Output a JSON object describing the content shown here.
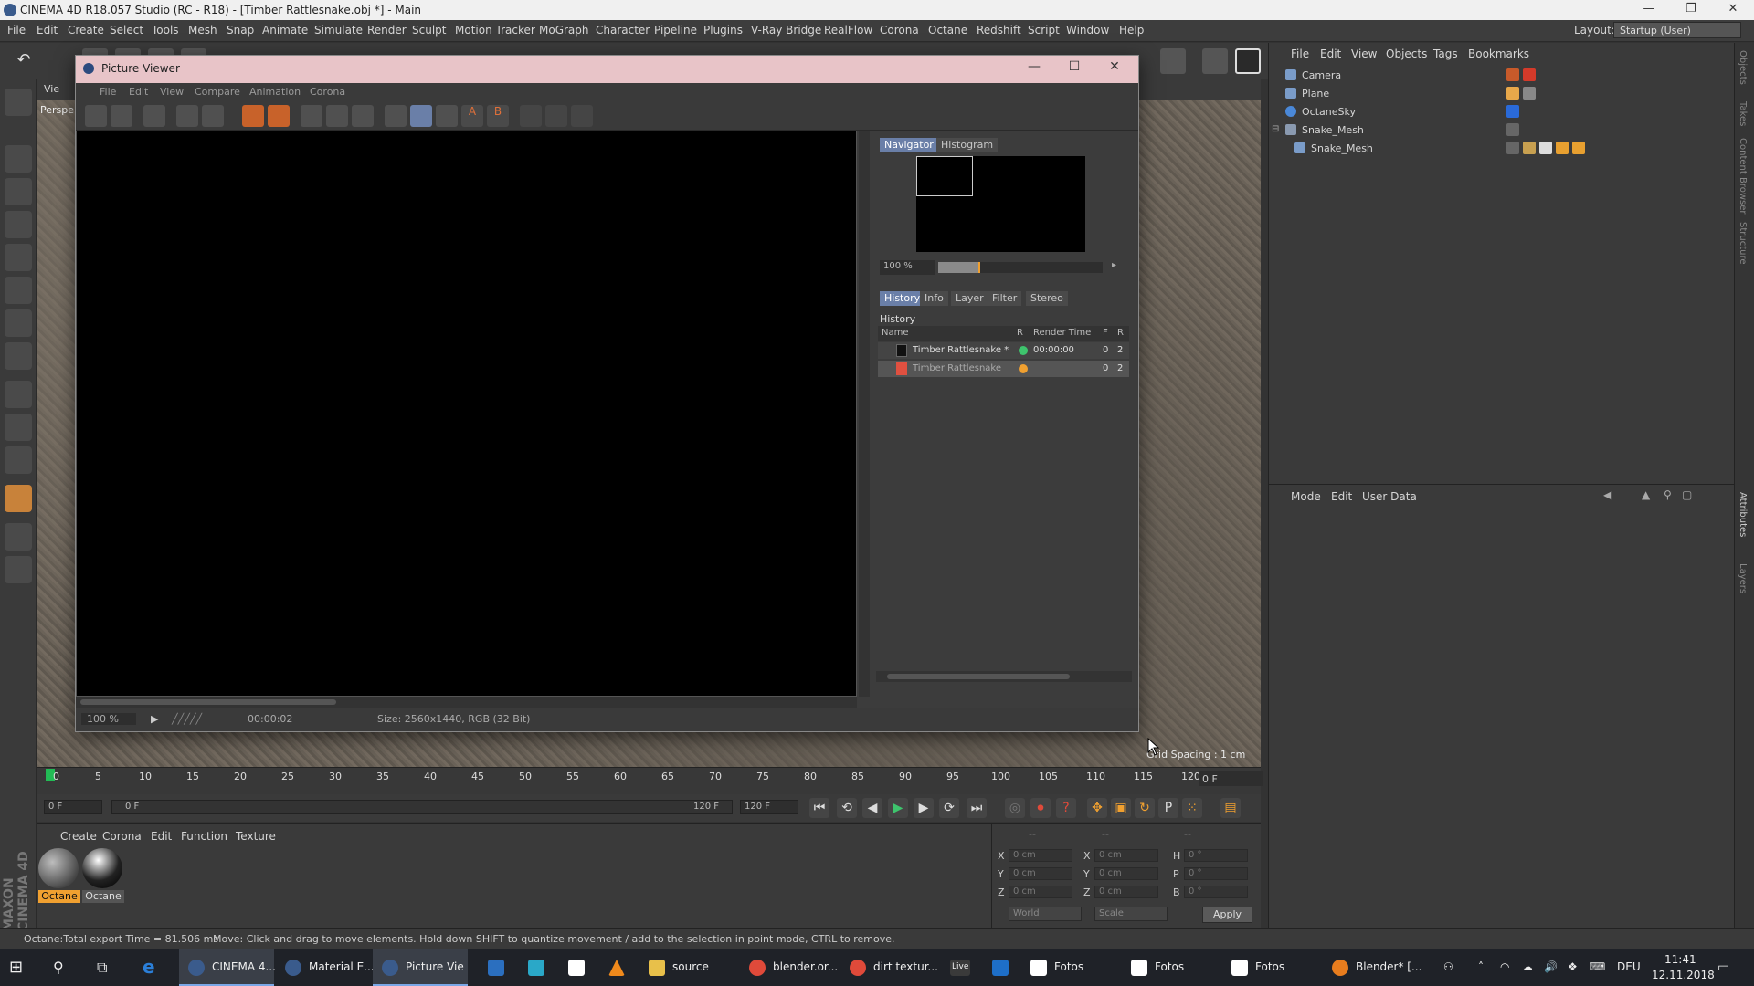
{
  "window": {
    "title": "CINEMA 4D R18.057 Studio (RC - R18) - [Timber Rattlesnake.obj *] - Main",
    "controls": [
      "—",
      "❐",
      "✕"
    ]
  },
  "menubar": {
    "items": [
      "File",
      "Edit",
      "Create",
      "Select",
      "Tools",
      "Mesh",
      "Snap",
      "Animate",
      "Simulate",
      "Render",
      "Sculpt",
      "Motion Tracker",
      "MoGraph",
      "Character",
      "Pipeline",
      "Plugins",
      "V-Ray Bridge",
      "RealFlow",
      "Corona",
      "Octane",
      "Redshift",
      "Script",
      "Window",
      "Help"
    ],
    "layout_label": "Layout:",
    "layout_value": "Startup (User)"
  },
  "viewport": {
    "label": "Perspe",
    "menu_first": "Vie",
    "grid_spacing": "Grid Spacing : 1 cm"
  },
  "timeline": {
    "ticks": [
      "0",
      "5",
      "10",
      "15",
      "20",
      "25",
      "30",
      "35",
      "40",
      "45",
      "50",
      "55",
      "60",
      "65",
      "70",
      "75",
      "80",
      "85",
      "90",
      "95",
      "100",
      "105",
      "110",
      "115",
      "120"
    ],
    "current_frame_right": "0 F",
    "start_frame": "0 F",
    "range_start": "0 F",
    "range_end": "120 F",
    "end_frame": "120 F"
  },
  "material_manager": {
    "menu": [
      "Create",
      "Corona",
      "Edit",
      "Function",
      "Texture"
    ],
    "materials": [
      {
        "name": "Octane",
        "selected": true
      },
      {
        "name": "Octane",
        "selected": false
      }
    ],
    "brand": "MAXON CINEMA 4D"
  },
  "coordinates": {
    "headers": [
      "--",
      "--",
      "--"
    ],
    "rows": [
      {
        "a": "X",
        "av": "0 cm",
        "b": "X",
        "bv": "0 cm",
        "c": "H",
        "cv": "0 °"
      },
      {
        "a": "Y",
        "av": "0 cm",
        "b": "Y",
        "bv": "0 cm",
        "c": "P",
        "cv": "0 °"
      },
      {
        "a": "Z",
        "av": "0 cm",
        "b": "Z",
        "bv": "0 cm",
        "c": "B",
        "cv": "0 °"
      }
    ],
    "mode1": "World",
    "mode2": "Scale",
    "apply": "Apply"
  },
  "object_manager": {
    "menu": [
      "File",
      "Edit",
      "View",
      "Objects",
      "Tags",
      "Bookmarks"
    ],
    "objects": [
      {
        "name": "Camera",
        "icon_color": "#7a9cc9"
      },
      {
        "name": "Plane",
        "icon_color": "#7a9cc9"
      },
      {
        "name": "OctaneSky",
        "icon_color": "#4a88d8"
      },
      {
        "name": "Snake_Mesh",
        "icon_color": "#7a9cc9"
      },
      {
        "name": "Snake_Mesh",
        "icon_color": "#7a9cc9"
      }
    ]
  },
  "attribute_manager": {
    "menu": [
      "Mode",
      "Edit",
      "User Data"
    ]
  },
  "right_tabs": [
    "Objects",
    "Takes",
    "Content Browser",
    "Structure",
    "Attributes",
    "Layers"
  ],
  "statusbar": {
    "left": "Octane:Total export Time = 81.506 ms",
    "message": "Move: Click and drag to move elements. Hold down SHIFT to quantize movement / add to the selection in point mode, CTRL to remove."
  },
  "picture_viewer": {
    "title": "Picture Viewer",
    "controls": [
      "—",
      "☐",
      "✕"
    ],
    "menu": [
      "File",
      "Edit",
      "View",
      "Compare",
      "Animation",
      "Corona"
    ],
    "zoom": "100 %",
    "time": "00:00:02",
    "size_info": "Size: 2560x1440, RGB (32 Bit)",
    "panel_tabs": [
      "Navigator",
      "Histogram"
    ],
    "nav_zoom": "100 %",
    "nav_zoom_fraction": 0.25,
    "sub_tabs": [
      "History",
      "Info",
      "Layer",
      "Filter",
      "Stereo"
    ],
    "history_label": "History",
    "history_columns": [
      "Name",
      "R",
      "Render Time",
      "F",
      "R"
    ],
    "history": [
      {
        "name": "Timber Rattlesnake *",
        "status_color": "#3ec46d",
        "time": "00:00:00",
        "f": "0",
        "r": "2",
        "swatch": "#111111"
      },
      {
        "name": "Timber Rattlesnake",
        "status_color": "#f0a030",
        "time": "",
        "f": "0",
        "r": "2",
        "swatch": "#e05040"
      }
    ]
  },
  "taskbar": {
    "apps": [
      {
        "label": "CINEMA 4...",
        "color": "#3a5b8c",
        "active": true
      },
      {
        "label": "Material E...",
        "color": "#3a5b8c",
        "active": false
      },
      {
        "label": "Picture Vie",
        "color": "#3a5b8c",
        "active": true
      },
      {
        "label": "",
        "color": "#2b6fbf",
        "active": false
      },
      {
        "label": "",
        "color": "#2aa8c8",
        "active": false
      },
      {
        "label": "",
        "color": "#ffffff",
        "active": false
      },
      {
        "label": "",
        "color": "#f08a1c",
        "active": false
      },
      {
        "label": "source",
        "color": "#e8c04a",
        "active": false
      },
      {
        "label": "blender.or...",
        "color": "#e04a3a",
        "active": false
      },
      {
        "label": "dirt textur...",
        "color": "#e04a3a",
        "active": false
      },
      {
        "label": "Live",
        "color": "#3a3a3a",
        "active": false
      },
      {
        "label": "",
        "color": "#1e6fc8",
        "active": false
      },
      {
        "label": "Fotos",
        "color": "#ffffff",
        "active": false
      },
      {
        "label": "Fotos",
        "color": "#ffffff",
        "active": false
      },
      {
        "label": "Fotos",
        "color": "#ffffff",
        "active": false
      },
      {
        "label": "Blender* [...",
        "color": "#e87d1e",
        "active": false
      }
    ],
    "lang": "DEU",
    "time": "11:41",
    "date": "12.11.2018"
  }
}
